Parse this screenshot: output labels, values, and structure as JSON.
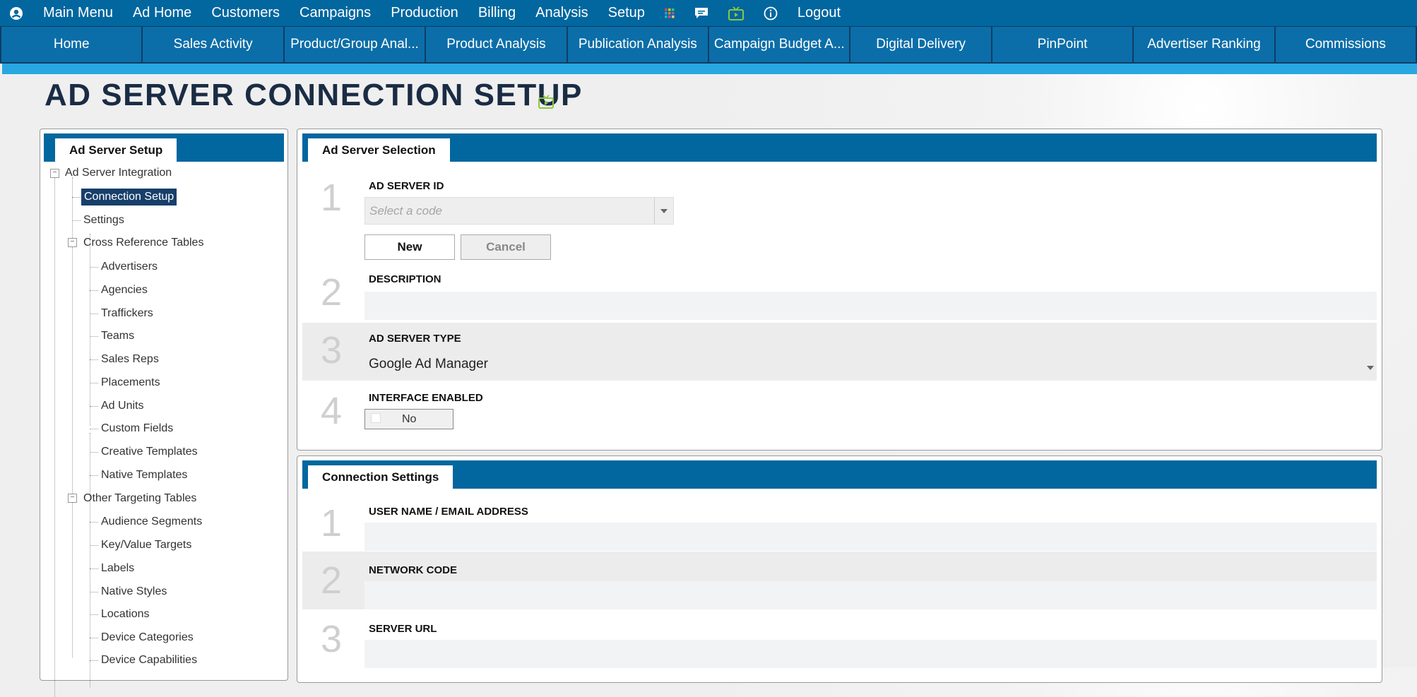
{
  "top_menu": {
    "items": [
      "Main Menu",
      "Ad Home",
      "Customers",
      "Campaigns",
      "Production",
      "Billing",
      "Analysis",
      "Setup"
    ],
    "logout": "Logout",
    "icons": [
      "user-icon",
      "grid-icon",
      "chat-icon",
      "tv-icon",
      "info-icon"
    ]
  },
  "module_tabs": [
    "Home",
    "Sales Activity",
    "Product/Group Anal...",
    "Product Analysis",
    "Publication Analysis",
    "Campaign Budget A...",
    "Digital Delivery",
    "PinPoint",
    "Advertiser Ranking",
    "Commissions"
  ],
  "page": {
    "title": "AD SERVER CONNECTION SETUP"
  },
  "sidebar": {
    "tab": "Ad Server Setup",
    "root": "Ad Server Integration",
    "items": {
      "connection_setup": "Connection Setup",
      "settings": "Settings",
      "cross_reference": "Cross Reference Tables",
      "cross_children": [
        "Advertisers",
        "Agencies",
        "Traffickers",
        "Teams",
        "Sales Reps",
        "Placements",
        "Ad Units",
        "Custom Fields",
        "Creative Templates",
        "Native Templates"
      ],
      "other_targeting": "Other Targeting Tables",
      "other_children": [
        "Audience Segments",
        "Key/Value Targets",
        "Labels",
        "Native Styles",
        "Locations",
        "Device Categories",
        "Device Capabilities"
      ]
    }
  },
  "selection_panel": {
    "tab": "Ad Server Selection",
    "fields": [
      {
        "num": "1",
        "label": "AD SERVER ID",
        "placeholder": "Select a code"
      },
      {
        "num": "2",
        "label": "DESCRIPTION",
        "value": ""
      },
      {
        "num": "3",
        "label": "AD SERVER TYPE",
        "value": "Google Ad Manager"
      },
      {
        "num": "4",
        "label": "INTERFACE ENABLED",
        "value": "No"
      }
    ],
    "buttons": {
      "new": "New",
      "cancel": "Cancel"
    }
  },
  "connection_panel": {
    "tab": "Connection Settings",
    "fields": [
      {
        "num": "1",
        "label": "USER NAME / EMAIL ADDRESS",
        "value": ""
      },
      {
        "num": "2",
        "label": "NETWORK CODE",
        "value": ""
      },
      {
        "num": "3",
        "label": "SERVER URL",
        "value": ""
      }
    ]
  },
  "colors": {
    "menu_bar": "#02679f",
    "tab_bar": "#0b6ea8",
    "accent": "#29a7e1",
    "selected": "#173f6b"
  }
}
